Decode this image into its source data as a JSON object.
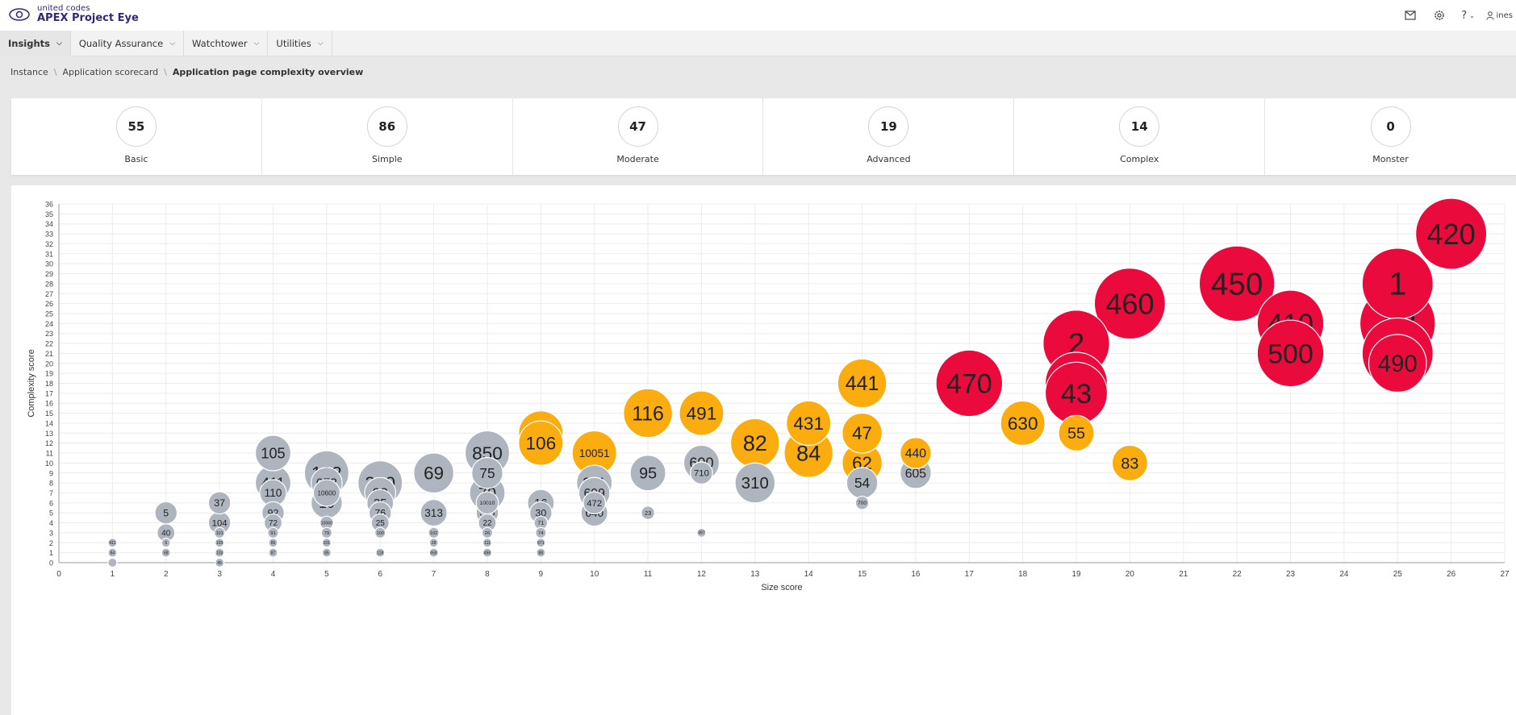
{
  "header": {
    "brand_small": "united codes",
    "brand_title": "APEX Project Eye",
    "user_label": "ines"
  },
  "nav": {
    "tabs": [
      {
        "label": "Insights"
      },
      {
        "label": "Quality Assurance"
      },
      {
        "label": "Watchtower"
      },
      {
        "label": "Utilities"
      }
    ]
  },
  "breadcrumb": {
    "items": [
      "Instance",
      "Application scorecard"
    ],
    "current": "Application page complexity overview"
  },
  "stats": [
    {
      "value": "55",
      "label": "Basic"
    },
    {
      "value": "86",
      "label": "Simple"
    },
    {
      "value": "47",
      "label": "Moderate"
    },
    {
      "value": "19",
      "label": "Advanced"
    },
    {
      "value": "14",
      "label": "Complex"
    },
    {
      "value": "0",
      "label": "Monster"
    }
  ],
  "colors": {
    "gray": "#aeb5bf",
    "orange": "#fbad0f",
    "red": "#ea0a3c",
    "brand": "#2f2a75"
  },
  "chart_data": {
    "type": "scatter",
    "title": "",
    "xlabel": "Size score",
    "ylabel": "Complexity score",
    "xlim": [
      0,
      27
    ],
    "ylim": [
      0,
      36
    ],
    "x_ticks": [
      0,
      1,
      2,
      3,
      4,
      5,
      6,
      7,
      8,
      9,
      10,
      11,
      12,
      13,
      14,
      15,
      16,
      17,
      18,
      19,
      20,
      21,
      22,
      23,
      24,
      25,
      26,
      27
    ],
    "y_ticks": [
      0,
      1,
      2,
      3,
      4,
      5,
      6,
      7,
      8,
      9,
      10,
      11,
      12,
      13,
      14,
      15,
      16,
      17,
      18,
      19,
      20,
      21,
      22,
      23,
      24,
      25,
      26,
      27,
      28,
      29,
      30,
      31,
      32,
      33,
      34,
      35,
      36
    ],
    "grid": true,
    "points": [
      {
        "x": 1,
        "y": 0,
        "label": "",
        "c": "gray",
        "s": 1
      },
      {
        "x": 1,
        "y": 1,
        "label": "84",
        "c": "gray",
        "s": 1
      },
      {
        "x": 1,
        "y": 2,
        "label": "411",
        "c": "gray",
        "s": 1
      },
      {
        "x": 2,
        "y": 1,
        "label": "68",
        "c": "gray",
        "s": 1
      },
      {
        "x": 2,
        "y": 2,
        "label": "6",
        "c": "gray",
        "s": 1
      },
      {
        "x": 2,
        "y": 3,
        "label": "40",
        "c": "gray",
        "s": 2
      },
      {
        "x": 2,
        "y": 5,
        "label": "5",
        "c": "gray",
        "s": 2.5
      },
      {
        "x": 3,
        "y": 0,
        "label": "45",
        "c": "gray",
        "s": 1
      },
      {
        "x": 3,
        "y": 1,
        "label": "103",
        "c": "gray",
        "s": 1
      },
      {
        "x": 3,
        "y": 2,
        "label": "103",
        "c": "gray",
        "s": 1
      },
      {
        "x": 3,
        "y": 3,
        "label": "101",
        "c": "gray",
        "s": 1.2
      },
      {
        "x": 3,
        "y": 4,
        "label": "104",
        "c": "gray",
        "s": 2.5
      },
      {
        "x": 3,
        "y": 6,
        "label": "37",
        "c": "gray",
        "s": 2.5
      },
      {
        "x": 4,
        "y": 1,
        "label": "87",
        "c": "gray",
        "s": 1
      },
      {
        "x": 4,
        "y": 2,
        "label": "86",
        "c": "gray",
        "s": 1
      },
      {
        "x": 4,
        "y": 3,
        "label": "91",
        "c": "gray",
        "s": 1.2
      },
      {
        "x": 4,
        "y": 4,
        "label": "72",
        "c": "gray",
        "s": 2
      },
      {
        "x": 4,
        "y": 5,
        "label": "92",
        "c": "gray",
        "s": 2.5
      },
      {
        "x": 4,
        "y": 8,
        "label": "411",
        "c": "gray",
        "s": 4
      },
      {
        "x": 4,
        "y": 7,
        "label": "110",
        "c": "gray",
        "s": 3
      },
      {
        "x": 4,
        "y": 11,
        "label": "105",
        "c": "gray",
        "s": 4
      },
      {
        "x": 5,
        "y": 1,
        "label": "85",
        "c": "gray",
        "s": 1
      },
      {
        "x": 5,
        "y": 2,
        "label": "101",
        "c": "gray",
        "s": 1
      },
      {
        "x": 5,
        "y": 3,
        "label": "79",
        "c": "gray",
        "s": 1.2
      },
      {
        "x": 5,
        "y": 4,
        "label": "10060",
        "c": "gray",
        "s": 1.5
      },
      {
        "x": 5,
        "y": 6,
        "label": "10",
        "c": "gray",
        "s": 3.5
      },
      {
        "x": 5,
        "y": 9,
        "label": "102",
        "c": "gray",
        "s": 5
      },
      {
        "x": 5,
        "y": 8,
        "label": "673",
        "c": "gray",
        "s": 3.5
      },
      {
        "x": 5,
        "y": 7,
        "label": "10600",
        "c": "gray",
        "s": 3
      },
      {
        "x": 6,
        "y": 1,
        "label": "118",
        "c": "gray",
        "s": 1
      },
      {
        "x": 6,
        "y": 3,
        "label": "100",
        "c": "gray",
        "s": 1.2
      },
      {
        "x": 6,
        "y": 4,
        "label": "25",
        "c": "gray",
        "s": 2
      },
      {
        "x": 6,
        "y": 5,
        "label": "76",
        "c": "gray",
        "s": 2.5
      },
      {
        "x": 6,
        "y": 6,
        "label": "35",
        "c": "gray",
        "s": 3
      },
      {
        "x": 6,
        "y": 7,
        "label": "93",
        "c": "gray",
        "s": 3.5
      },
      {
        "x": 6,
        "y": 8,
        "label": "300",
        "c": "gray",
        "s": 5
      },
      {
        "x": 7,
        "y": 1,
        "label": "658",
        "c": "gray",
        "s": 1
      },
      {
        "x": 7,
        "y": 2,
        "label": "28",
        "c": "gray",
        "s": 1
      },
      {
        "x": 7,
        "y": 3,
        "label": "102",
        "c": "gray",
        "s": 1.2
      },
      {
        "x": 7,
        "y": 5,
        "label": "313",
        "c": "gray",
        "s": 3
      },
      {
        "x": 7,
        "y": 9,
        "label": "69",
        "c": "gray",
        "s": 4.5
      },
      {
        "x": 8,
        "y": 1,
        "label": "496",
        "c": "gray",
        "s": 1
      },
      {
        "x": 8,
        "y": 2,
        "label": "111",
        "c": "gray",
        "s": 1
      },
      {
        "x": 8,
        "y": 3,
        "label": "26",
        "c": "gray",
        "s": 1.2
      },
      {
        "x": 8,
        "y": 4,
        "label": "22",
        "c": "gray",
        "s": 2
      },
      {
        "x": 8,
        "y": 5,
        "label": "315",
        "c": "gray",
        "s": 2.5
      },
      {
        "x": 8,
        "y": 6,
        "label": "10010",
        "c": "gray",
        "s": 2.5
      },
      {
        "x": 8,
        "y": 7,
        "label": "70",
        "c": "gray",
        "s": 4
      },
      {
        "x": 8,
        "y": 9,
        "label": "75",
        "c": "gray",
        "s": 3.5
      },
      {
        "x": 8,
        "y": 11,
        "label": "850",
        "c": "gray",
        "s": 5
      },
      {
        "x": 9,
        "y": 1,
        "label": "88",
        "c": "gray",
        "s": 1
      },
      {
        "x": 9,
        "y": 2,
        "label": "671",
        "c": "gray",
        "s": 1
      },
      {
        "x": 9,
        "y": 3,
        "label": "74",
        "c": "gray",
        "s": 1.2
      },
      {
        "x": 9,
        "y": 4,
        "label": "71",
        "c": "gray",
        "s": 1.5
      },
      {
        "x": 9,
        "y": 5,
        "label": "30",
        "c": "gray",
        "s": 2.5
      },
      {
        "x": 9,
        "y": 6,
        "label": "16",
        "c": "gray",
        "s": 3
      },
      {
        "x": 9,
        "y": 13,
        "label": "480",
        "c": "orange",
        "s": 5
      },
      {
        "x": 9,
        "y": 12,
        "label": "106",
        "c": "orange",
        "s": 5
      },
      {
        "x": 10,
        "y": 5,
        "label": "640",
        "c": "gray",
        "s": 3
      },
      {
        "x": 10,
        "y": 6,
        "label": "472",
        "c": "gray",
        "s": 2.5
      },
      {
        "x": 10,
        "y": 7,
        "label": "699",
        "c": "gray",
        "s": 3.5
      },
      {
        "x": 10,
        "y": 8,
        "label": "311",
        "c": "gray",
        "s": 4
      },
      {
        "x": 10,
        "y": 11,
        "label": "10051",
        "c": "orange",
        "s": 5
      },
      {
        "x": 11,
        "y": 5,
        "label": "23",
        "c": "gray",
        "s": 1.5
      },
      {
        "x": 11,
        "y": 9,
        "label": "95",
        "c": "gray",
        "s": 4
      },
      {
        "x": 11,
        "y": 15,
        "label": "116",
        "c": "orange",
        "s": 5.5
      },
      {
        "x": 12,
        "y": 3,
        "label": "497",
        "c": "gray",
        "s": 1
      },
      {
        "x": 12,
        "y": 10,
        "label": "600",
        "c": "gray",
        "s": 4
      },
      {
        "x": 12,
        "y": 9,
        "label": "710",
        "c": "gray",
        "s": 2.5
      },
      {
        "x": 12,
        "y": 15,
        "label": "491",
        "c": "orange",
        "s": 5
      },
      {
        "x": 13,
        "y": 8,
        "label": "310",
        "c": "gray",
        "s": 4.5
      },
      {
        "x": 13,
        "y": 12,
        "label": "82",
        "c": "orange",
        "s": 5.5
      },
      {
        "x": 14,
        "y": 14,
        "label": "431",
        "c": "orange",
        "s": 5
      },
      {
        "x": 14,
        "y": 11,
        "label": "84",
        "c": "orange",
        "s": 5.5
      },
      {
        "x": 15,
        "y": 6,
        "label": "700",
        "c": "gray",
        "s": 1.5
      },
      {
        "x": 15,
        "y": 8,
        "label": "54",
        "c": "gray",
        "s": 3.5
      },
      {
        "x": 15,
        "y": 10,
        "label": "62",
        "c": "orange",
        "s": 4.5
      },
      {
        "x": 15,
        "y": 13,
        "label": "47",
        "c": "orange",
        "s": 4.5
      },
      {
        "x": 15,
        "y": 18,
        "label": "441",
        "c": "orange",
        "s": 5.5
      },
      {
        "x": 16,
        "y": 9,
        "label": "605",
        "c": "gray",
        "s": 3.5
      },
      {
        "x": 16,
        "y": 11,
        "label": "440",
        "c": "orange",
        "s": 3.5
      },
      {
        "x": 17,
        "y": 18,
        "label": "470",
        "c": "red",
        "s": 7.5
      },
      {
        "x": 18,
        "y": 14,
        "label": "630",
        "c": "orange",
        "s": 5
      },
      {
        "x": 19,
        "y": 13,
        "label": "55",
        "c": "orange",
        "s": 4
      },
      {
        "x": 19,
        "y": 22,
        "label": "2",
        "c": "red",
        "s": 7.5
      },
      {
        "x": 19,
        "y": 18,
        "label": "",
        "c": "red",
        "s": 7
      },
      {
        "x": 19,
        "y": 17,
        "label": "43",
        "c": "red",
        "s": 7
      },
      {
        "x": 20,
        "y": 10,
        "label": "83",
        "c": "orange",
        "s": 4
      },
      {
        "x": 20,
        "y": 26,
        "label": "460",
        "c": "red",
        "s": 8
      },
      {
        "x": 22,
        "y": 28,
        "label": "450",
        "c": "red",
        "s": 8.5
      },
      {
        "x": 23,
        "y": 24,
        "label": "410",
        "c": "red",
        "s": 7.5
      },
      {
        "x": 23,
        "y": 21,
        "label": "500",
        "c": "red",
        "s": 7.5
      },
      {
        "x": 25,
        "y": 28,
        "label": "1",
        "c": "red",
        "s": 8
      },
      {
        "x": 25,
        "y": 24,
        "label": "48",
        "c": "red",
        "s": 8.5
      },
      {
        "x": 25,
        "y": 21,
        "label": "670",
        "c": "red",
        "s": 8
      },
      {
        "x": 25,
        "y": 20,
        "label": "490",
        "c": "red",
        "s": 6.5
      },
      {
        "x": 26,
        "y": 33,
        "label": "420",
        "c": "red",
        "s": 8
      }
    ]
  }
}
